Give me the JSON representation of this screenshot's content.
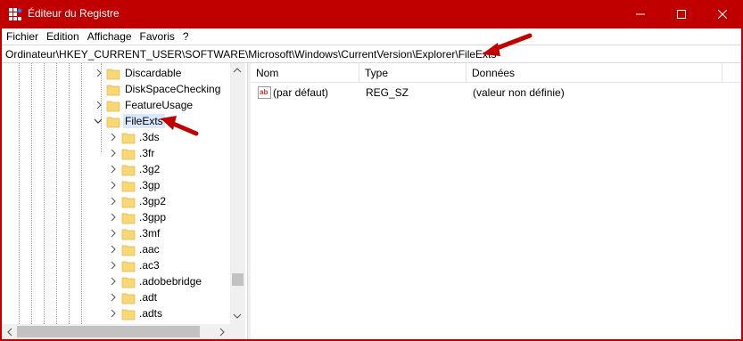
{
  "window": {
    "title": "Éditeur du Registre",
    "accent_color": "#c00000"
  },
  "menu": [
    "Fichier",
    "Edition",
    "Affichage",
    "Favoris",
    "?"
  ],
  "address": "Ordinateur\\HKEY_CURRENT_USER\\SOFTWARE\\Microsoft\\Windows\\CurrentVersion\\Explorer\\FileExts",
  "tree": {
    "parent_items": [
      {
        "label": "Discardable",
        "expander": "chevron-right-icon"
      },
      {
        "label": "DiskSpaceChecking",
        "expander": "none"
      },
      {
        "label": "FeatureUsage",
        "expander": "chevron-right-icon"
      }
    ],
    "selected_item": {
      "label": "FileExts",
      "expander": "chevron-down-icon"
    },
    "children": [
      ".3ds",
      ".3fr",
      ".3g2",
      ".3gp",
      ".3gp2",
      ".3gpp",
      ".3mf",
      ".aac",
      ".ac3",
      ".adobebridge",
      ".adt",
      ".adts"
    ]
  },
  "list": {
    "columns": [
      "Nom",
      "Type",
      "Données"
    ],
    "rows": [
      {
        "name": "(par défaut)",
        "type": "REG_SZ",
        "data": "(valeur non définie)",
        "icon": "string-value-icon"
      }
    ]
  },
  "annotation_color": "#c00000"
}
